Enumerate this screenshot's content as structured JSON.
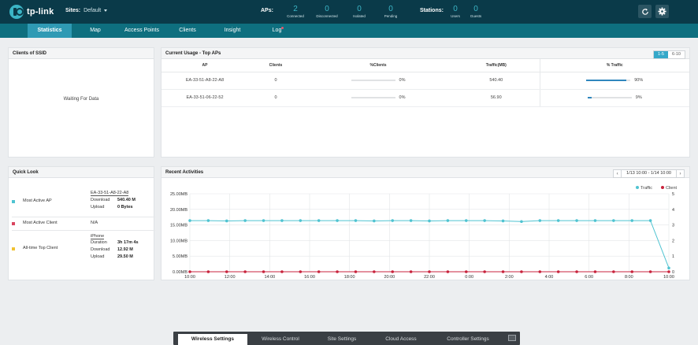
{
  "header": {
    "logo_text": "tp-link",
    "sites_label": "Sites:",
    "sites_value": "Default",
    "aps_label": "APs:",
    "aps": [
      {
        "num": "2",
        "cap": "Connected"
      },
      {
        "num": "0",
        "cap": "Disconnected"
      },
      {
        "num": "0",
        "cap": "Isolated"
      },
      {
        "num": "0",
        "cap": "Pending"
      }
    ],
    "stations_label": "Stations:",
    "stations": [
      {
        "num": "0",
        "cap": "Users"
      },
      {
        "num": "0",
        "cap": "Guests"
      }
    ]
  },
  "nav": {
    "tabs": [
      "Statistics",
      "Map",
      "Access Points",
      "Clients",
      "Insight",
      "Log"
    ],
    "active": "Statistics"
  },
  "ssid_panel": {
    "title": "Clients of SSID",
    "waiting": "Waiting For Data"
  },
  "usage_panel": {
    "title": "Current Usage - Top APs",
    "pager": [
      "1-5",
      "6-10"
    ],
    "columns": [
      "AP",
      "Clients",
      "%Clients",
      "Traffic(MB)",
      "% Traffic"
    ],
    "rows": [
      {
        "ap": "EA-33-51-A8-22-A8",
        "clients": "0",
        "pct_clients": "0%",
        "pct_clients_value": 0,
        "traffic": "540.40",
        "pct_traffic": "90%",
        "pct_traffic_value": 90
      },
      {
        "ap": "EA-33-51-06-22-52",
        "clients": "0",
        "pct_clients": "0%",
        "pct_clients_value": 0,
        "traffic": "56.90",
        "pct_traffic": "9%",
        "pct_traffic_value": 9
      }
    ]
  },
  "quick_look": {
    "title": "Quick Look",
    "most_active_ap": {
      "label": "Most Active AP",
      "name": "EA-33-51-A8-22-A8",
      "download_label": "Download",
      "download": "540.40 M",
      "upload_label": "Upload",
      "upload": "0 Bytes",
      "color": "#4fc3d1"
    },
    "most_active_client": {
      "label": "Most Active Client",
      "value": "N/A",
      "color": "#d9445e"
    },
    "all_time_top_client": {
      "label": "All-time Top Client",
      "name": "iPhone",
      "duration_label": "Duration",
      "duration": "3h 17m 4s",
      "download_label": "Download",
      "download": "12.92 M",
      "upload_label": "Upload",
      "upload": "29.50 M",
      "color": "#f1c232"
    }
  },
  "recent": {
    "title": "Recent Activities",
    "range": "1/13 10:00 - 1/14 10:00",
    "prev_icon": "chevron-left-icon",
    "next_icon": "chevron-right-icon"
  },
  "chart_data": {
    "type": "line",
    "title": "",
    "x": [
      "10:00",
      "12:00",
      "14:00",
      "16:00",
      "18:00",
      "20:00",
      "22:00",
      "0:00",
      "2:00",
      "4:00",
      "6:00",
      "8:00",
      "10:00"
    ],
    "y_left_ticks": [
      "0.00MB",
      "5.00MB",
      "10.00MB",
      "15.00MB",
      "20.00MB",
      "25.00MB"
    ],
    "y_left_range": [
      0,
      25
    ],
    "y_right_ticks": [
      "0",
      "1",
      "2",
      "3",
      "4",
      "5"
    ],
    "y_right_range": [
      0,
      5
    ],
    "legend": [
      "Traffic",
      "Client"
    ],
    "legend_position": "top-right",
    "grid": true,
    "series": [
      {
        "name": "Traffic",
        "axis": "left",
        "unit": "MB",
        "color": "#4fc3d1",
        "values": [
          16.4,
          16.4,
          16.3,
          16.4,
          16.4,
          16.4,
          16.4,
          16.4,
          16.4,
          16.4,
          16.3,
          16.4,
          16.4,
          16.3,
          16.4,
          16.4,
          16.4,
          16.3,
          16.1,
          16.4,
          16.4,
          16.4,
          16.4,
          16.4,
          16.4,
          16.4,
          1.2
        ]
      },
      {
        "name": "Client",
        "axis": "right",
        "color": "#c8233c",
        "values": [
          0,
          0,
          0,
          0,
          0,
          0,
          0,
          0,
          0,
          0,
          0,
          0,
          0,
          0,
          0,
          0,
          0,
          0,
          0,
          0,
          0,
          0,
          0,
          0,
          0,
          0,
          0
        ]
      }
    ]
  },
  "bottom": {
    "tabs": [
      "Wireless Settings",
      "Wireless Control",
      "Site Settings",
      "Cloud Access",
      "Controller Settings"
    ],
    "active": "Wireless Settings"
  }
}
